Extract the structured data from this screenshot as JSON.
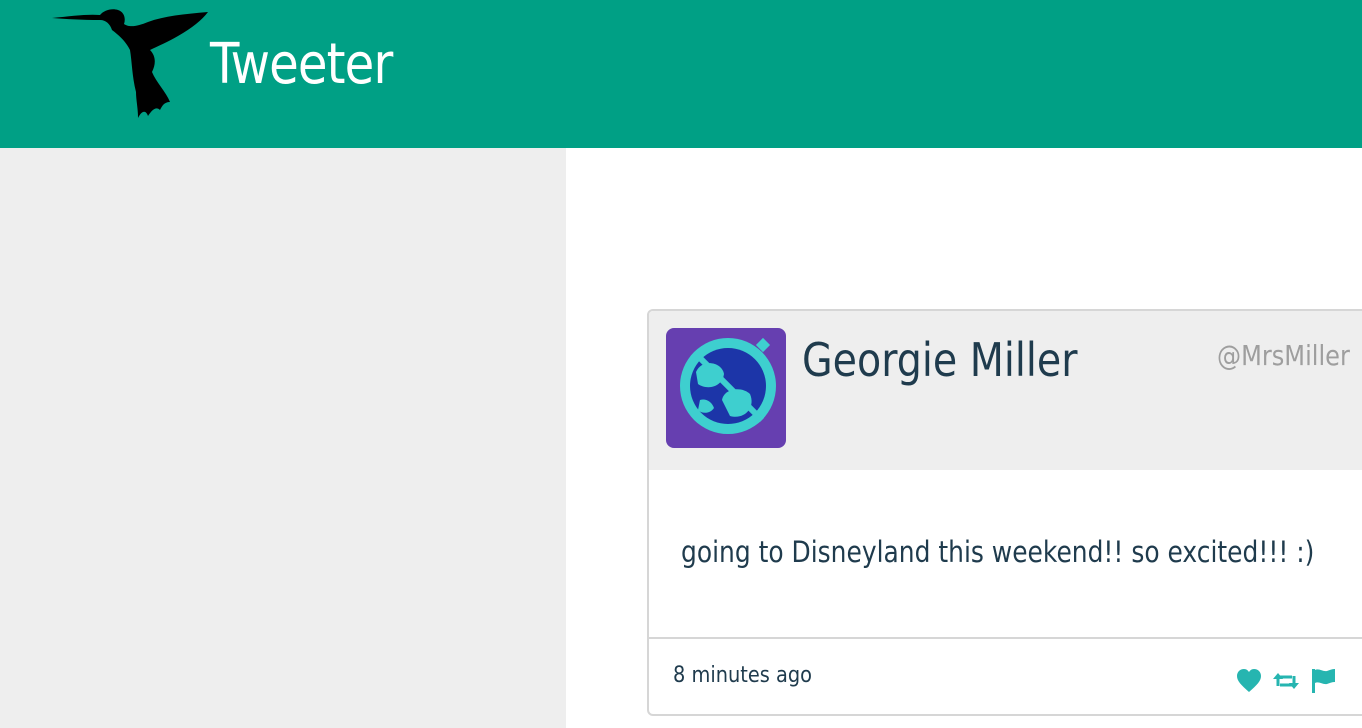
{
  "header": {
    "app_title": "Tweeter",
    "logo_icon": "hummingbird-icon",
    "background_color": "#00a085"
  },
  "tweet": {
    "author_name": "Georgie Miller",
    "handle": "@MrsMiller",
    "avatar_icon": "sunglasses-avatar-icon",
    "avatar_colors": {
      "background": "#663fb0",
      "ring": "#3ecfcf",
      "inner": "#1c35a8"
    },
    "text": "going to Disneyland this weekend!! so excited!!! :)",
    "timestamp": "8 minutes ago",
    "actions": [
      {
        "name": "like",
        "icon": "heart-icon"
      },
      {
        "name": "retweet",
        "icon": "retweet-icon"
      },
      {
        "name": "report",
        "icon": "flag-icon"
      }
    ],
    "accent_color": "#26b5b0"
  }
}
